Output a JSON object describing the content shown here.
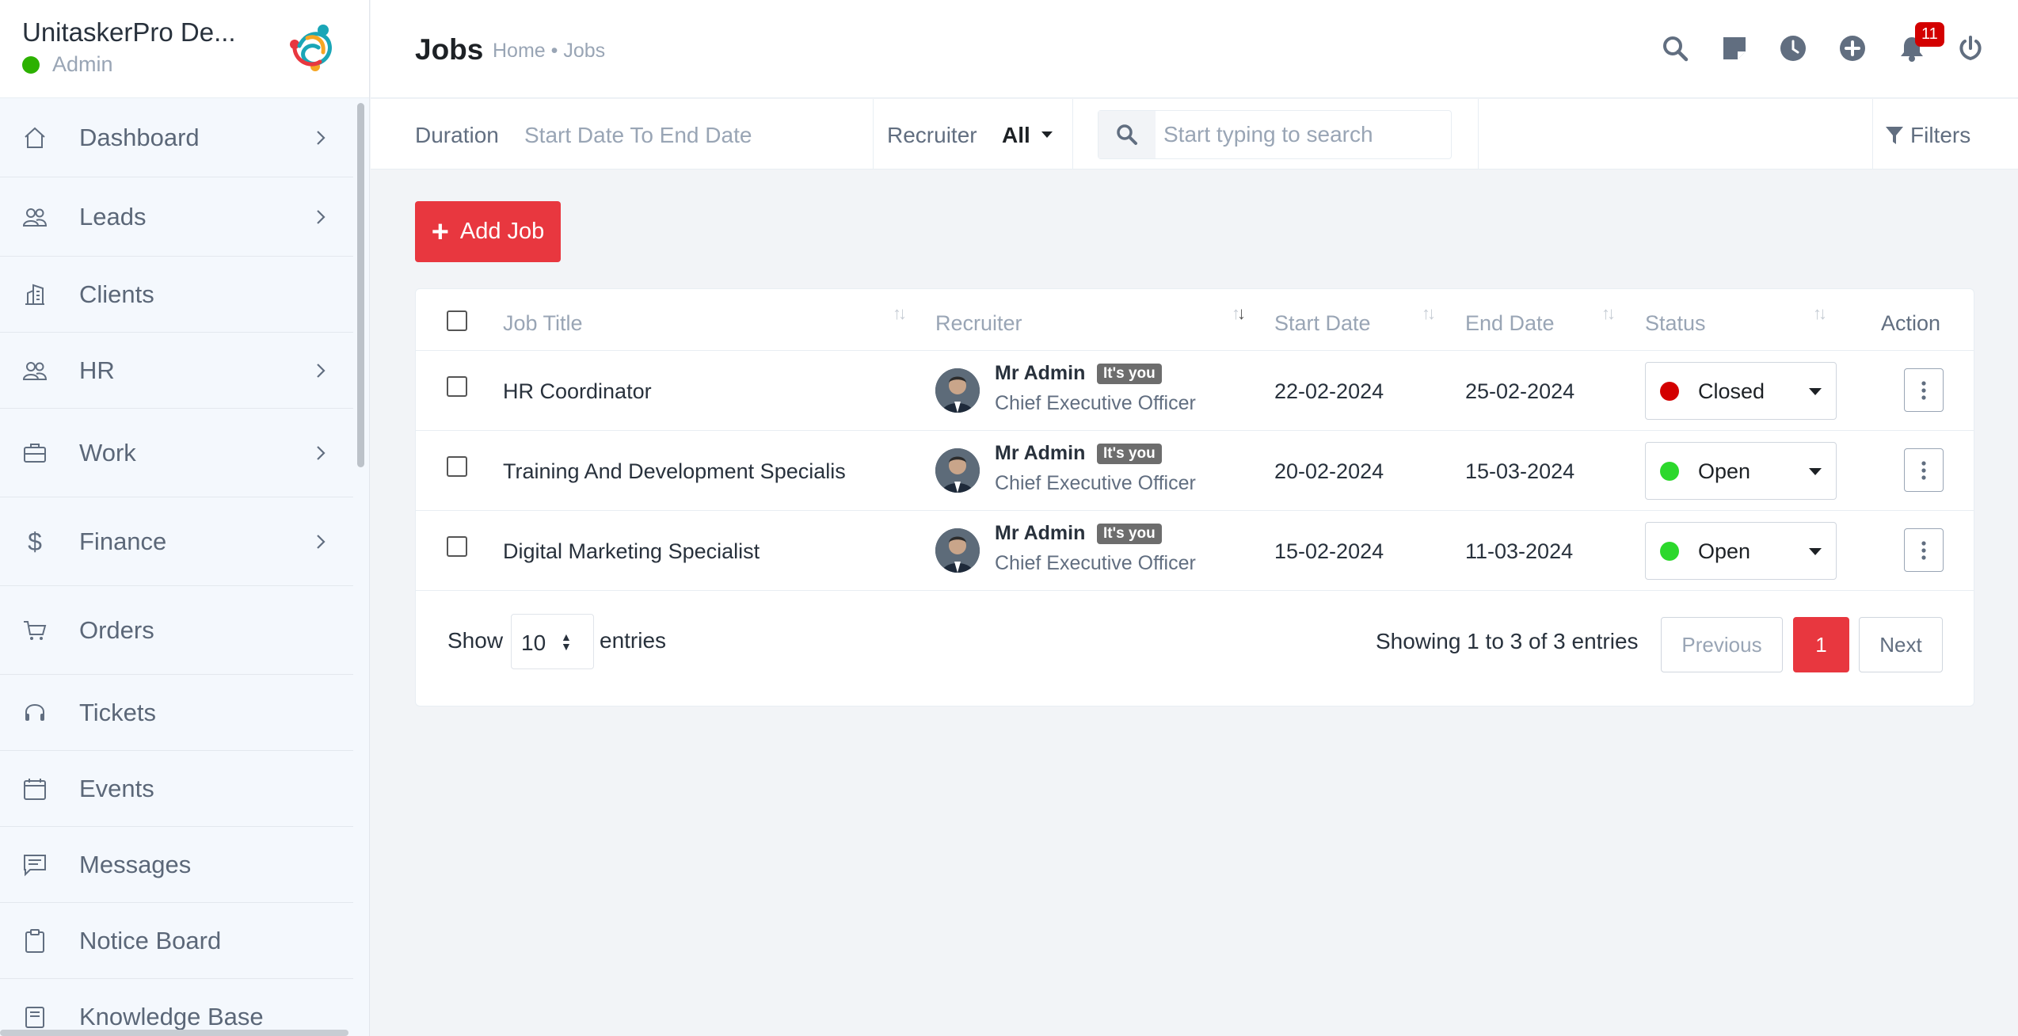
{
  "brand": {
    "name": "UnitaskerPro De...",
    "role": "Admin"
  },
  "sidebar": {
    "items": [
      {
        "label": "Dashboard",
        "icon": "home-icon",
        "has_children": true
      },
      {
        "label": "Leads",
        "icon": "users-icon",
        "has_children": true
      },
      {
        "label": "Clients",
        "icon": "building-icon",
        "has_children": false
      },
      {
        "label": "HR",
        "icon": "users-icon",
        "has_children": true
      },
      {
        "label": "Work",
        "icon": "briefcase-icon",
        "has_children": true
      },
      {
        "label": "Finance",
        "icon": "dollar-icon",
        "has_children": true
      },
      {
        "label": "Orders",
        "icon": "cart-icon",
        "has_children": false
      },
      {
        "label": "Tickets",
        "icon": "headset-icon",
        "has_children": false
      },
      {
        "label": "Events",
        "icon": "calendar-icon",
        "has_children": false
      },
      {
        "label": "Messages",
        "icon": "message-icon",
        "has_children": false
      },
      {
        "label": "Notice Board",
        "icon": "clipboard-icon",
        "has_children": false
      },
      {
        "label": "Knowledge Base",
        "icon": "book-icon",
        "has_children": false
      }
    ]
  },
  "header": {
    "title": "Jobs",
    "breadcrumb": "Home • Jobs",
    "icons": [
      "search-icon",
      "sticky-note-icon",
      "clock-icon",
      "plus-circle-icon",
      "bell-icon",
      "power-icon"
    ],
    "notification_count": "11"
  },
  "filters": {
    "duration_label": "Duration",
    "duration_value": "Start Date To End Date",
    "recruiter_label": "Recruiter",
    "recruiter_value": "All",
    "search_placeholder": "Start typing to search",
    "filters_label": "Filters"
  },
  "actions": {
    "add_job": "Add Job"
  },
  "table": {
    "columns": [
      "Job Title",
      "Recruiter",
      "Start Date",
      "End Date",
      "Status",
      "Action"
    ],
    "rows": [
      {
        "title": "HR Coordinator",
        "recruiter": "Mr Admin",
        "badge": "It's you",
        "recruiter_title": "Chief Executive Officer",
        "start": "22-02-2024",
        "end": "25-02-2024",
        "status": "Closed",
        "status_color": "#d30000"
      },
      {
        "title": "Training And Development Specialis",
        "recruiter": "Mr Admin",
        "badge": "It's you",
        "recruiter_title": "Chief Executive Officer",
        "start": "20-02-2024",
        "end": "15-03-2024",
        "status": "Open",
        "status_color": "#2cd82c"
      },
      {
        "title": "Digital Marketing Specialist",
        "recruiter": "Mr Admin",
        "badge": "It's you",
        "recruiter_title": "Chief Executive Officer",
        "start": "15-02-2024",
        "end": "11-03-2024",
        "status": "Open",
        "status_color": "#2cd82c"
      }
    ]
  },
  "pagination": {
    "show_label": "Show",
    "page_length": "10",
    "entries_label": "entries",
    "summary": "Showing 1 to 3 of 3 entries",
    "previous": "Previous",
    "current_page": "1",
    "next": "Next"
  },
  "colors": {
    "accent": "#e8373f",
    "closed": "#d30000",
    "open": "#2cd82c",
    "online": "#2cb100"
  }
}
